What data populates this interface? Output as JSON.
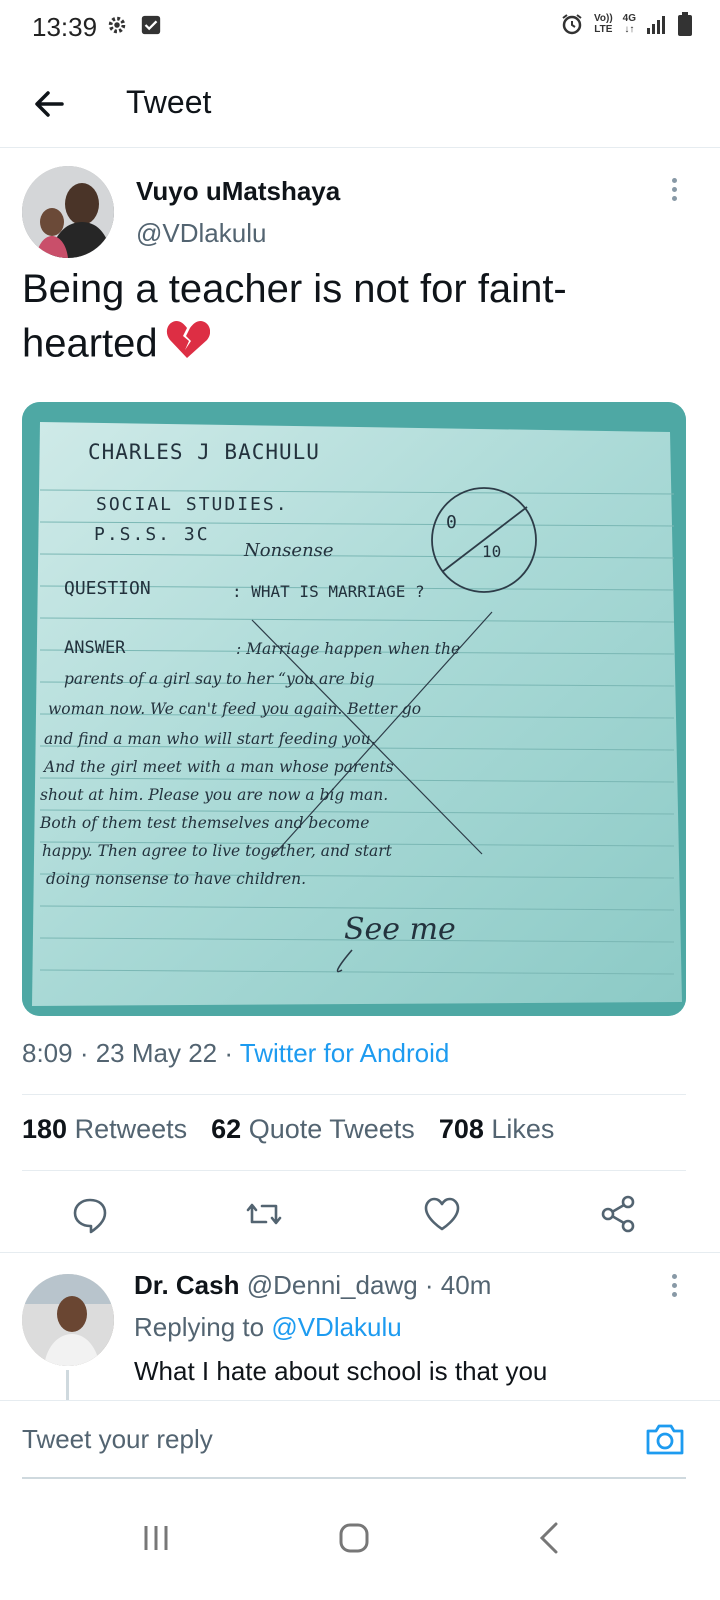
{
  "status_bar": {
    "time": "13:39",
    "volte_top": "Vo))",
    "volte_bottom": "LTE",
    "network": "4G",
    "icons": [
      "gear-icon",
      "checkbox-icon",
      "alarm-icon",
      "signal-icon",
      "battery-icon"
    ]
  },
  "header": {
    "title": "Tweet"
  },
  "tweet": {
    "author_name": "Vuyo uMatshaya",
    "author_handle": "@VDlakulu",
    "text": "Being a teacher is not for faint-hearted",
    "emoji": "broken-heart-icon",
    "image": {
      "line1": "CHARLES J BACHULU",
      "line2": "SOCIAL STUDIES.",
      "line3": "P.S.S. 3C",
      "score_top": "0",
      "score_bottom": "10",
      "remark": "Nonsense",
      "question_label": "QUESTION",
      "question": ": WHAT IS MARRIAGE ?",
      "answer_label": "ANSWER",
      "answer_lines": [
        ": Marriage happen when the",
        "parents of a girl say to her “you are big",
        "woman now. We can't feed you again. Better go",
        "and find a man who will start feeding you.",
        "And the girl meet with a man whose parents",
        "shout at him. Please you are now a big man.",
        "Both of them test themselves and become",
        "happy. Then agree to live together, and start",
        "doing nonsense to have children."
      ],
      "signoff": "See me"
    },
    "time": "8:09",
    "date": "23 May 22",
    "source": "Twitter for Android",
    "stats": {
      "retweets_count": "180",
      "retweets_label": "Retweets",
      "quotes_count": "62",
      "quotes_label": "Quote Tweets",
      "likes_count": "708",
      "likes_label": "Likes"
    }
  },
  "reply": {
    "name": "Dr. Cash",
    "handle": "@Denni_dawg",
    "age": "40m",
    "replying_prefix": "Replying to",
    "replying_to": "@VDlakulu",
    "text": "What I hate about school is that you"
  },
  "compose": {
    "placeholder": "Tweet your reply"
  },
  "colors": {
    "accent": "#1d9bf0",
    "muted": "#536471",
    "text": "#0f1419",
    "paper": "#5fb4b0"
  }
}
